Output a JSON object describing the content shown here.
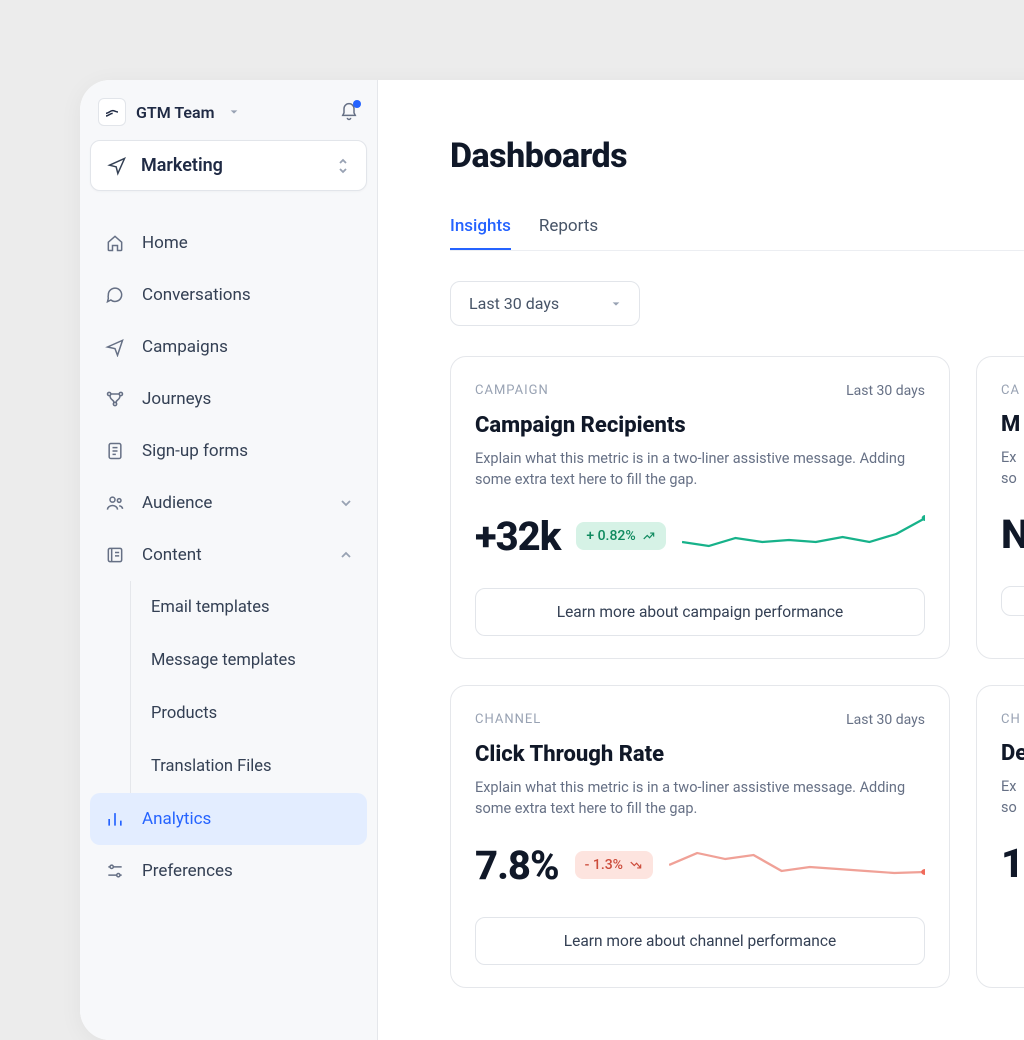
{
  "workspace": {
    "name": "GTM Team"
  },
  "nav_select": {
    "label": "Marketing"
  },
  "sidebar": {
    "items": [
      {
        "label": "Home"
      },
      {
        "label": "Conversations"
      },
      {
        "label": "Campaigns"
      },
      {
        "label": "Journeys"
      },
      {
        "label": "Sign-up forms"
      },
      {
        "label": "Audience"
      },
      {
        "label": "Content"
      },
      {
        "label": "Analytics"
      },
      {
        "label": "Preferences"
      }
    ],
    "content_sub": [
      {
        "label": "Email templates"
      },
      {
        "label": "Message templates"
      },
      {
        "label": "Products"
      },
      {
        "label": "Translation Files"
      }
    ]
  },
  "page": {
    "title": "Dashboards"
  },
  "tabs": [
    {
      "label": "Insights"
    },
    {
      "label": "Reports"
    }
  ],
  "range": {
    "label": "Last 30 days"
  },
  "cards": [
    {
      "category": "CAMPAIGN",
      "range": "Last 30 days",
      "title": "Campaign Recipients",
      "desc": "Explain what this metric is in a two-liner assistive message. Adding some extra text here to fill the gap.",
      "metric": "+32k",
      "delta": "+ 0.82%",
      "delta_dir": "up",
      "cta": "Learn more about campaign performance"
    },
    {
      "category": "CA",
      "range": "",
      "title": "M",
      "desc": "Ex\nso",
      "metric": "N",
      "delta": "",
      "delta_dir": "",
      "cta": ""
    },
    {
      "category": "CHANNEL",
      "range": "Last 30 days",
      "title": "Click Through Rate",
      "desc": "Explain what this metric is in a two-liner assistive message. Adding some extra text here to fill the gap.",
      "metric": "7.8%",
      "delta": "- 1.3%",
      "delta_dir": "down",
      "cta": "Learn more about channel performance"
    },
    {
      "category": "CH",
      "range": "",
      "title": "De",
      "desc": "Ex\nso",
      "metric": "1",
      "delta": "",
      "delta_dir": "",
      "cta": ""
    }
  ],
  "chart_data": [
    {
      "type": "line",
      "title": "Campaign Recipients sparkline",
      "x": [
        0,
        1,
        2,
        3,
        4,
        5,
        6,
        7,
        8,
        9
      ],
      "values": [
        30,
        26,
        32,
        29,
        31,
        30,
        33,
        30,
        34,
        44
      ],
      "color": "#17b28a"
    },
    {
      "type": "line",
      "title": "Click Through Rate sparkline",
      "x": [
        0,
        1,
        2,
        3,
        4,
        5,
        6,
        7,
        8,
        9
      ],
      "values": [
        26,
        38,
        32,
        36,
        22,
        26,
        24,
        22,
        20,
        21
      ],
      "color": "#f06a5a"
    }
  ]
}
